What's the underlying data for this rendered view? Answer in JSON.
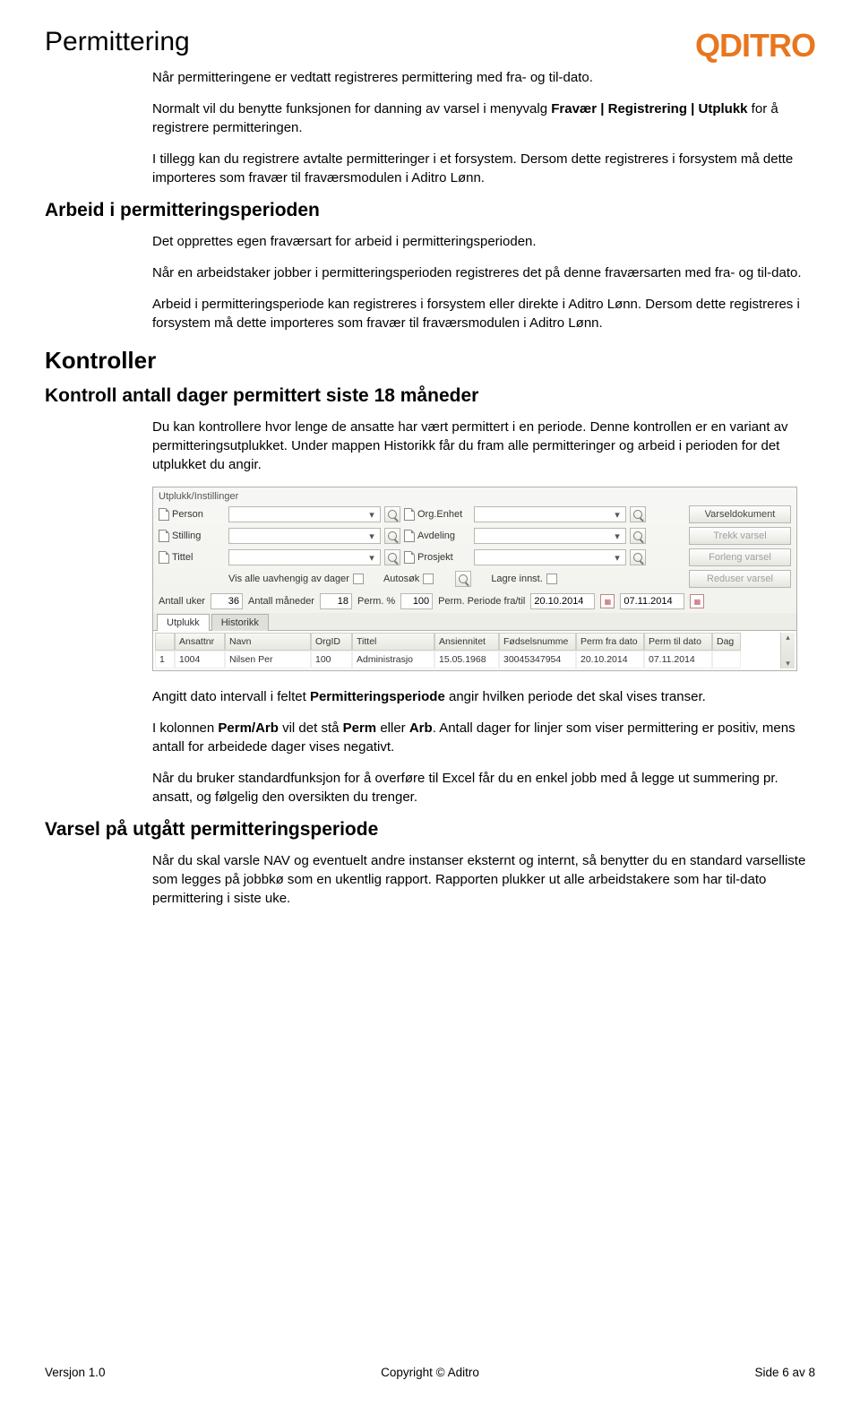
{
  "header": {
    "title": "Permittering",
    "logo": "QDITRO"
  },
  "s1": {
    "p1": "Når permitteringene er vedtatt registreres permittering med fra- og til-dato.",
    "p2a": "Normalt vil du benytte funksjonen for danning av varsel i menyvalg ",
    "p2b": "Fravær | Registrering | Utplukk",
    "p2c": " for å registrere permitteringen.",
    "p3": "I tillegg kan du registrere avtalte permitteringer i et forsystem. Dersom dette registreres i forsystem må dette importeres som fravær til fraværsmodulen i Aditro Lønn."
  },
  "h_arbeid": "Arbeid i permitteringsperioden",
  "s2": {
    "p1": "Det opprettes egen fraværsart for arbeid i permitteringsperioden.",
    "p2": "Når en arbeidstaker jobber i permitteringsperioden registreres det på denne fraværsarten med fra- og til-dato.",
    "p3": "Arbeid i permitteringsperiode kan registreres i forsystem eller direkte i Aditro Lønn. Dersom dette registreres i forsystem må dette importeres som fravær til fraværsmodulen i Aditro Lønn."
  },
  "h_kontroller": "Kontroller",
  "h_kontroll18": "Kontroll antall dager permittert siste 18 måneder",
  "s3": {
    "p1": "Du kan kontrollere hvor lenge de ansatte har vært permittert i en periode. Denne kontrollen er en variant av permitteringsutplukket. Under mappen Historikk får du fram alle permitteringer og arbeid i perioden for det utplukket du angir."
  },
  "ui": {
    "panel_title": "Utplukk/Instillinger",
    "labels": {
      "person": "Person",
      "stilling": "Stilling",
      "tittel": "Tittel",
      "orgenhet": "Org.Enhet",
      "avdeling": "Avdeling",
      "prosjekt": "Prosjekt",
      "vis_uavh": "Vis alle uavhengig av dager",
      "autosok": "Autosøk",
      "lagre_innst": "Lagre innst.",
      "antall_uker": "Antall uker",
      "antall_mnd": "Antall måneder",
      "perm_pct": "Perm. %",
      "perm_periode": "Perm. Periode fra/til"
    },
    "buttons": {
      "varseldok": "Varseldokument",
      "trekk": "Trekk varsel",
      "forleng": "Forleng varsel",
      "reduser": "Reduser varsel"
    },
    "values": {
      "uker": "36",
      "mnd": "18",
      "pct": "100",
      "fra": "20.10.2014",
      "til": "07.11.2014"
    },
    "tabs": {
      "utplukk": "Utplukk",
      "historikk": "Historikk"
    },
    "grid": {
      "cols": {
        "ansattnr": "Ansattnr",
        "navn": "Navn",
        "orgid": "OrgID",
        "tittel": "Tittel",
        "ansiennitet": "Ansiennitet",
        "fnr": "Fødselsnumme",
        "perm_fra": "Perm fra dato",
        "perm_til": "Perm til dato",
        "dag": "Dag"
      },
      "row": {
        "n": "1",
        "ansattnr": "1004",
        "navn": "Nilsen Per",
        "orgid": "100",
        "tittel": "Administrasjo",
        "ansiennitet": "15.05.1968",
        "fnr": "30045347954",
        "perm_fra": "20.10.2014",
        "perm_til": "07.11.2014"
      }
    }
  },
  "s4": {
    "p1a": "Angitt dato intervall i feltet ",
    "p1b": "Permitteringsperiode",
    "p1c": " angir hvilken periode det skal vises transer.",
    "p2a": "I kolonnen ",
    "p2b": "Perm/Arb",
    "p2c": " vil det stå ",
    "p2d": "Perm",
    "p2e": " eller ",
    "p2f": "Arb",
    "p2g": ". Antall dager for linjer som viser permittering er positiv, mens antall for arbeidede dager vises negativt.",
    "p3": "Når du bruker standardfunksjon for å overføre til Excel får du en enkel jobb med å legge ut summering pr. ansatt, og følgelig den oversikten du trenger."
  },
  "h_varsel": "Varsel på utgått permitteringsperiode",
  "s5": {
    "p1": "Når du skal varsle NAV og eventuelt andre instanser eksternt og internt, så benytter du en standard varselliste som legges på jobbkø som en ukentlig rapport. Rapporten plukker ut alle arbeidstakere som har til-dato permittering i siste uke."
  },
  "footer": {
    "left": "Versjon 1.0",
    "center": "Copyright © Aditro",
    "right": "Side 6 av 8"
  }
}
